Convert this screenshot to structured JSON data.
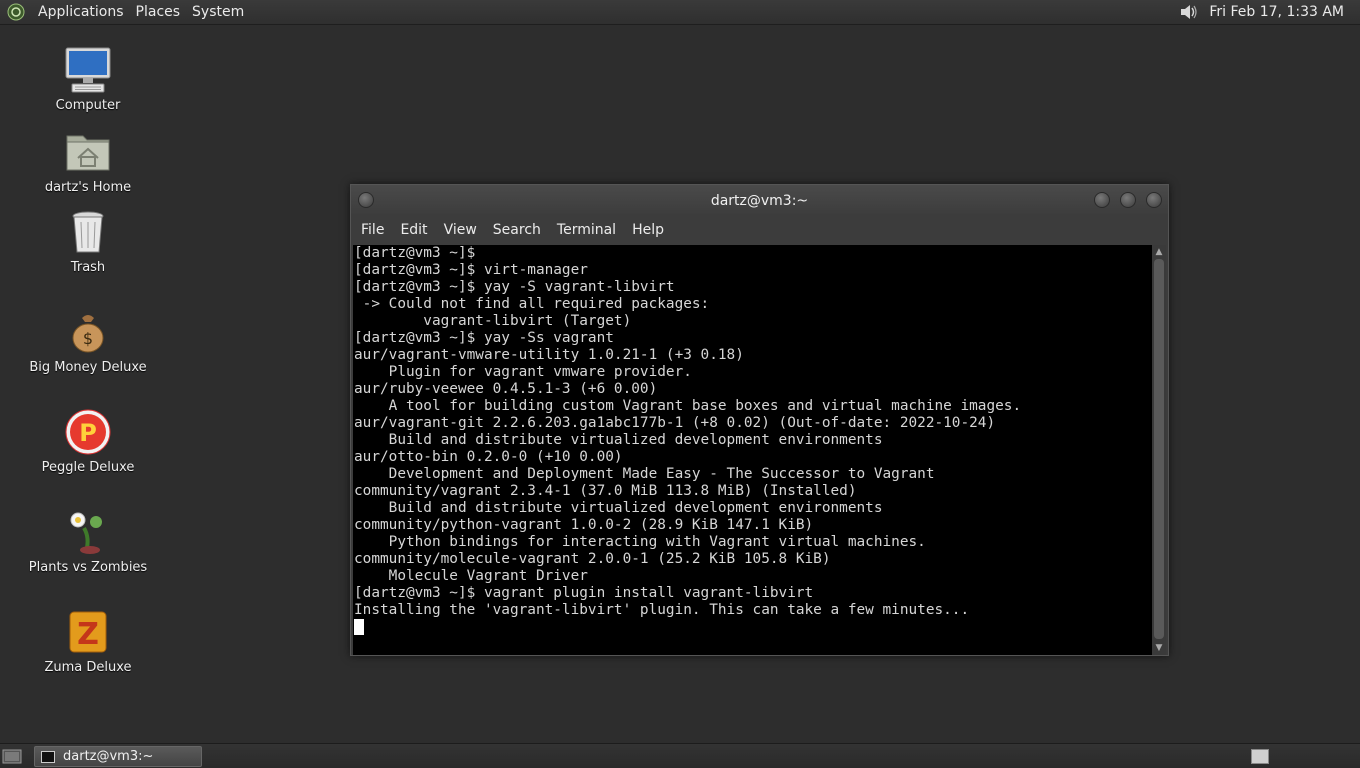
{
  "top_panel": {
    "menus": [
      "Applications",
      "Places",
      "System"
    ],
    "clock": "Fri Feb 17,  1:33 AM",
    "icons": {
      "logo": "gnome-foot-icon",
      "volume": "volume-icon"
    }
  },
  "desktop_icons": [
    {
      "label": "Computer",
      "icon": "computer-icon"
    },
    {
      "label": "dartz's Home",
      "icon": "home-folder-icon"
    },
    {
      "label": "Trash",
      "icon": "trash-icon"
    },
    {
      "label": "Big Money Deluxe",
      "icon": "money-bag-icon"
    },
    {
      "label": "Peggle Deluxe",
      "icon": "peggle-icon"
    },
    {
      "label": "Plants vs Zombies",
      "icon": "plants-vs-zombies-icon"
    },
    {
      "label": "Zuma Deluxe",
      "icon": "zuma-icon"
    }
  ],
  "terminal": {
    "title": "dartz@vm3:~",
    "menu": [
      "File",
      "Edit",
      "View",
      "Search",
      "Terminal",
      "Help"
    ],
    "lines": [
      "[dartz@vm3 ~]$",
      "[dartz@vm3 ~]$ virt-manager",
      "[dartz@vm3 ~]$ yay -S vagrant-libvirt",
      " -> Could not find all required packages:",
      "        vagrant-libvirt (Target)",
      "[dartz@vm3 ~]$ yay -Ss vagrant",
      "aur/vagrant-vmware-utility 1.0.21-1 (+3 0.18)",
      "    Plugin for vagrant vmware provider.",
      "aur/ruby-veewee 0.4.5.1-3 (+6 0.00)",
      "    A tool for building custom Vagrant base boxes and virtual machine images.",
      "aur/vagrant-git 2.2.6.203.ga1abc177b-1 (+8 0.02) (Out-of-date: 2022-10-24)",
      "    Build and distribute virtualized development environments",
      "aur/otto-bin 0.2.0-0 (+10 0.00)",
      "    Development and Deployment Made Easy - The Successor to Vagrant",
      "community/vagrant 2.3.4-1 (37.0 MiB 113.8 MiB) (Installed)",
      "    Build and distribute virtualized development environments",
      "community/python-vagrant 1.0.0-2 (28.9 KiB 147.1 KiB)",
      "    Python bindings for interacting with Vagrant virtual machines.",
      "community/molecule-vagrant 2.0.0-1 (25.2 KiB 105.8 KiB)",
      "    Molecule Vagrant Driver",
      "[dartz@vm3 ~]$ vagrant plugin install vagrant-libvirt",
      "Installing the 'vagrant-libvirt' plugin. This can take a few minutes..."
    ]
  },
  "taskbar": {
    "tasks": [
      "dartz@vm3:~"
    ]
  }
}
